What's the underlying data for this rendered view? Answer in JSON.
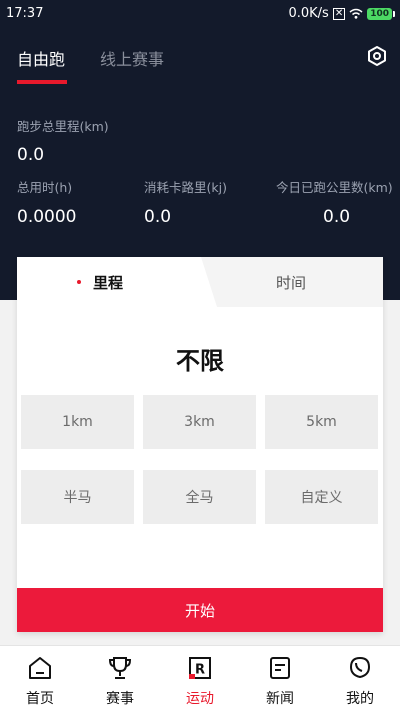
{
  "status_bar": {
    "time": "17:37",
    "network_speed": "0.0K/s",
    "battery": "100"
  },
  "top_tabs": [
    {
      "label": "自由跑",
      "active": true
    },
    {
      "label": "线上赛事",
      "active": false
    }
  ],
  "stats": {
    "total_distance": {
      "label": "跑步总里程(km)",
      "value": "0.0"
    },
    "total_time": {
      "label": "总用时(h)",
      "value": "0.0000"
    },
    "calories": {
      "label": "消耗卡路里(kj)",
      "value": "0.0"
    },
    "today_distance": {
      "label": "今日已跑公里数(km)",
      "value": "0.0"
    }
  },
  "mode_tabs": {
    "distance": "里程",
    "time": "时间",
    "active": "distance"
  },
  "target_display": "不限",
  "distance_options": [
    "1km",
    "3km",
    "5km",
    "半马",
    "全马",
    "自定义"
  ],
  "start_button": "开始",
  "bottom_nav": [
    {
      "label": "首页",
      "icon": "home-icon",
      "active": false
    },
    {
      "label": "赛事",
      "icon": "trophy-icon",
      "active": false
    },
    {
      "label": "运动",
      "icon": "run-icon",
      "active": true
    },
    {
      "label": "新闻",
      "icon": "news-icon",
      "active": false
    },
    {
      "label": "我的",
      "icon": "profile-icon",
      "active": false
    }
  ],
  "colors": {
    "header_bg": "#131a2b",
    "accent": "#e8192c",
    "start_button": "#ec1a3b"
  }
}
